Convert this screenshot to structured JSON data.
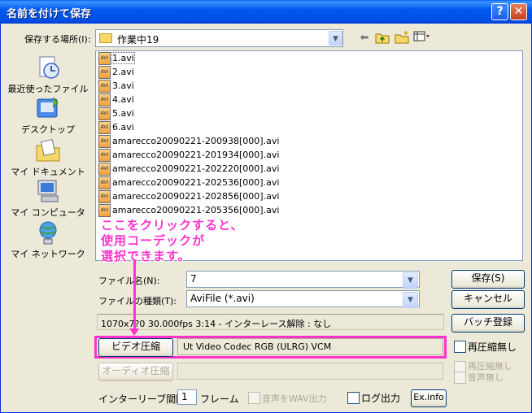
{
  "window": {
    "title": "名前を付けて保存",
    "help_label": "?",
    "close_label": "✕"
  },
  "save_in": {
    "label": "保存する場所(I):",
    "value": "作業中19"
  },
  "toolbar": {
    "back_icon": "back-arrow-icon",
    "up_icon": "up-folder-icon",
    "new_folder_icon": "new-folder-icon",
    "view_menu_icon": "view-menu-icon"
  },
  "places": [
    {
      "label": "最近使ったファイル",
      "icon": "recent-documents-icon"
    },
    {
      "label": "デスクトップ",
      "icon": "desktop-icon"
    },
    {
      "label": "マイ ドキュメント",
      "icon": "my-documents-icon"
    },
    {
      "label": "マイ コンピュータ",
      "icon": "my-computer-icon"
    },
    {
      "label": "マイ ネットワーク",
      "icon": "my-network-icon"
    }
  ],
  "files": [
    "1.avi",
    "2.avi",
    "3.avi",
    "4.avi",
    "5.avi",
    "6.avi",
    "amarecco20090221-200938[000].avi",
    "amarecco20090221-201934[000].avi",
    "amarecco20090221-202220[000].avi",
    "amarecco20090221-202536[000].avi",
    "amarecco20090221-202856[000].avi",
    "amarecco20090221-205356[000].avi"
  ],
  "file_icon_text": "AVI",
  "annotation": {
    "line1": "ここをクリックすると、",
    "line2": "使用コーデックが",
    "line3": "選択できます。"
  },
  "filename": {
    "label": "ファイル名(N):",
    "value": "7"
  },
  "filetype": {
    "label": "ファイルの種類(T):",
    "value": "AviFile (*.avi)"
  },
  "buttons": {
    "save": "保存(S)",
    "cancel": "キャンセル",
    "batch": "バッチ登録",
    "video_compress": "ビデオ圧縮",
    "audio_compress": "オーディオ圧縮",
    "exinfo": "Ex.info"
  },
  "info_bar": "1070x7?0  30.000fps  3:14  -  インターレース解除 : なし",
  "video_codec": "Ut Video Codec RGB (ULRG) VCM",
  "checkboxes": {
    "no_recompress_video": "再圧縮無し",
    "no_recompress_audio": "再圧縮無し",
    "mute_audio": "音声無し",
    "audio_to_wav": "音声をWAV出力",
    "log_output": "ログ出力"
  },
  "interleave": {
    "label": "インターリーブ間隔 :",
    "value": "1",
    "unit": "フレーム"
  }
}
